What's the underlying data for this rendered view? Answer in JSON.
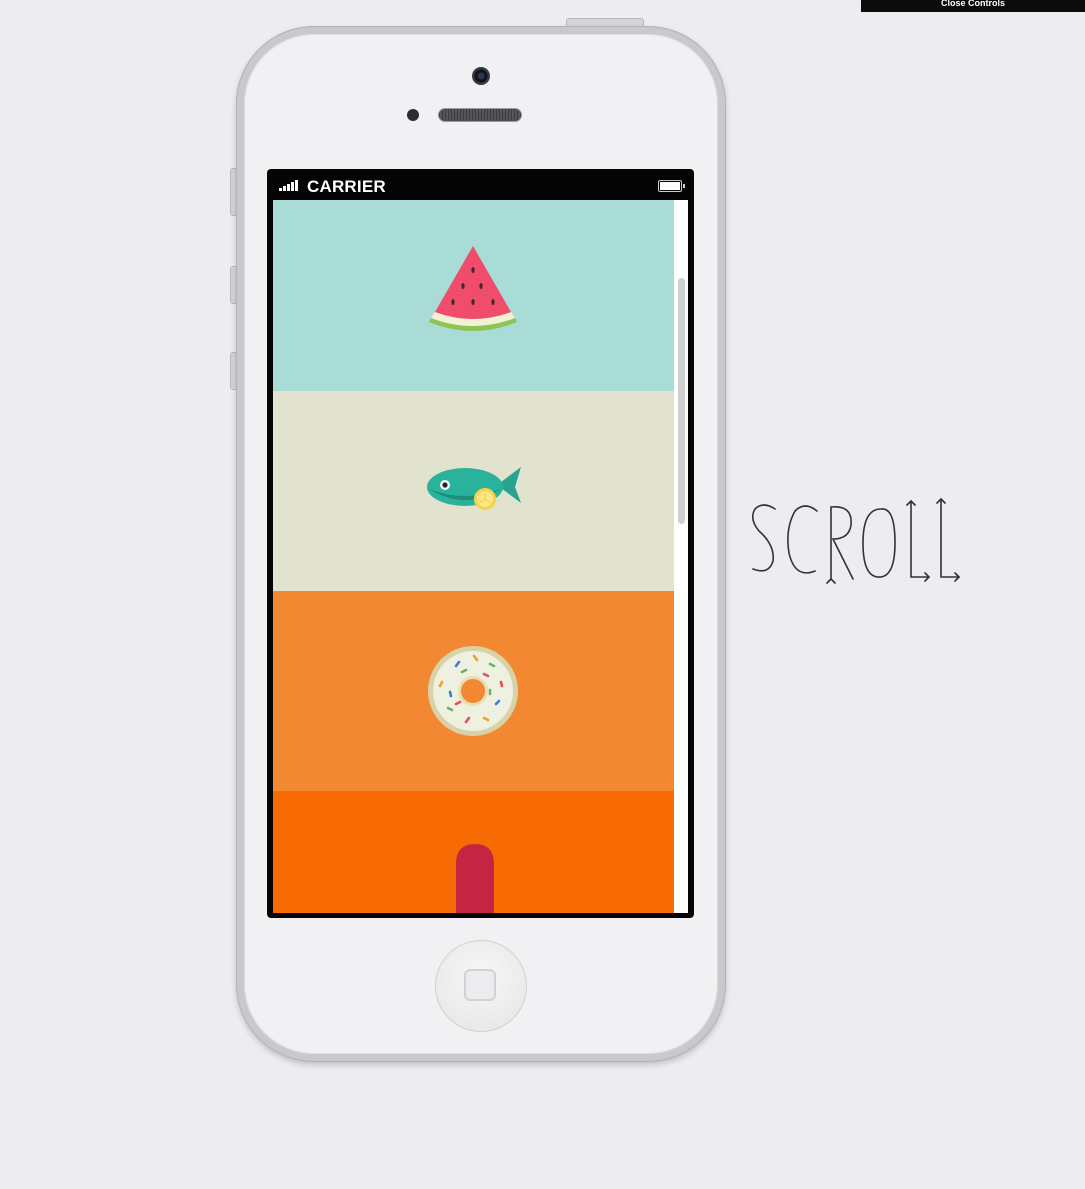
{
  "controls": {
    "close_label": "Close Controls"
  },
  "status_bar": {
    "carrier": "CARRIER",
    "signal_icon": "signal-bars-icon",
    "battery_icon": "battery-icon"
  },
  "screen": {
    "panels": [
      {
        "name": "watermelon",
        "color": "#aadcd7",
        "icon": "watermelon-icon"
      },
      {
        "name": "fish",
        "color": "#e1e3cf",
        "icon": "fish-icon"
      },
      {
        "name": "donut",
        "color": "#f28832",
        "icon": "donut-icon"
      },
      {
        "name": "popsicle",
        "color": "#f86a04",
        "icon": "popsicle-icon"
      }
    ]
  },
  "hint": {
    "scroll_text": "SCROLL"
  }
}
